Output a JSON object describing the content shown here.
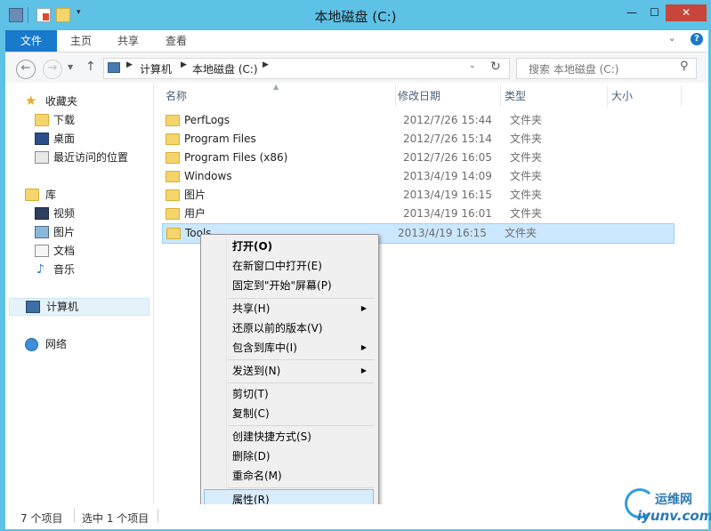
{
  "window": {
    "title": "本地磁盘 (C:)",
    "controls": [
      "—",
      "☐",
      "✕"
    ]
  },
  "ribbon": {
    "tabs": [
      "文件",
      "主页",
      "共享",
      "查看"
    ]
  },
  "address": {
    "path": [
      "计算机",
      "本地磁盘 (C:)"
    ],
    "search_placeholder": "搜索 本地磁盘 (C:)"
  },
  "sidebar": {
    "favorites": {
      "label": "收藏夹",
      "items": [
        "下载",
        "桌面",
        "最近访问的位置"
      ]
    },
    "libraries": {
      "label": "库",
      "items": [
        "视频",
        "图片",
        "文档",
        "音乐"
      ]
    },
    "computer": "计算机",
    "network": "网络"
  },
  "columns": [
    "名称",
    "修改日期",
    "类型",
    "大小"
  ],
  "files": [
    {
      "name": "PerfLogs",
      "date": "2012/7/26 15:44",
      "type": "文件夹"
    },
    {
      "name": "Program Files",
      "date": "2012/7/26 15:14",
      "type": "文件夹"
    },
    {
      "name": "Program Files (x86)",
      "date": "2012/7/26 16:05",
      "type": "文件夹"
    },
    {
      "name": "Windows",
      "date": "2013/4/19 14:09",
      "type": "文件夹"
    },
    {
      "name": "图片",
      "date": "2013/4/19 16:15",
      "type": "文件夹"
    },
    {
      "name": "用户",
      "date": "2013/4/19 16:01",
      "type": "文件夹"
    },
    {
      "name": "Tools",
      "date": "2013/4/19 16:15",
      "type": "文件夹"
    }
  ],
  "context_menu": {
    "open": "打开(O)",
    "open_new": "在新窗口中打开(E)",
    "pin_start": "固定到\"开始\"屏幕(P)",
    "share": "共享(H)",
    "restore": "还原以前的版本(V)",
    "include_library": "包含到库中(I)",
    "send_to": "发送到(N)",
    "cut": "剪切(T)",
    "copy": "复制(C)",
    "create_shortcut": "创建快捷方式(S)",
    "delete": "删除(D)",
    "rename": "重命名(M)",
    "properties": "属性(R)"
  },
  "status": {
    "item_count": "7 个项目",
    "selected": "选中 1 个项目"
  },
  "watermark": {
    "text1": "运维网",
    "text2": "iyunv.com"
  },
  "colors": {
    "titlebar": "#5ec1e6",
    "file_tab": "#1979ca",
    "selection": "#cce8ff",
    "close": "#c7453b"
  }
}
